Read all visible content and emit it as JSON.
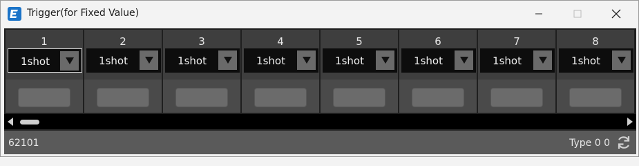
{
  "window": {
    "title": "Trigger(for Fixed Value)"
  },
  "channels": [
    {
      "number": "1",
      "mode": "1shot",
      "focused": true
    },
    {
      "number": "2",
      "mode": "1shot",
      "focused": false
    },
    {
      "number": "3",
      "mode": "1shot",
      "focused": false
    },
    {
      "number": "4",
      "mode": "1shot",
      "focused": false
    },
    {
      "number": "5",
      "mode": "1shot",
      "focused": false
    },
    {
      "number": "6",
      "mode": "1shot",
      "focused": false
    },
    {
      "number": "7",
      "mode": "1shot",
      "focused": false
    },
    {
      "number": "8",
      "mode": "1shot",
      "focused": false
    }
  ],
  "scroll": {
    "position": 0
  },
  "status": {
    "id": "62101",
    "type": "Type 0 0"
  },
  "icons": {
    "app": "app-logo-icon",
    "dropdown": "chevron-down-icon",
    "sync": "sync-icon"
  },
  "colors": {
    "accent": "#1a73c8",
    "panel": "#3e3e3e",
    "status_bar": "#5a5a5a"
  }
}
